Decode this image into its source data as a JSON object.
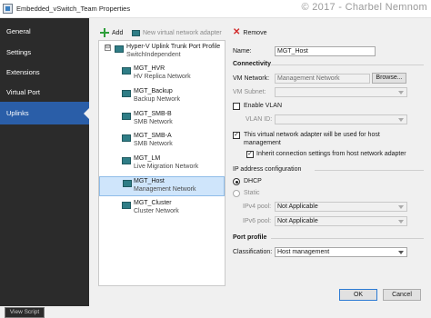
{
  "window": {
    "title": "Embedded_vSwitch_Team Properties"
  },
  "watermark": "© 2017 - Charbel Nemnom",
  "sidebar": {
    "items": [
      {
        "label": "General"
      },
      {
        "label": "Settings"
      },
      {
        "label": "Extensions"
      },
      {
        "label": "Virtual Port"
      },
      {
        "label": "Uplinks"
      }
    ],
    "active": "Uplinks",
    "view_script": "View Script"
  },
  "toolbar": {
    "add": "Add",
    "new_adapter": "New virtual network adapter",
    "remove": "Remove"
  },
  "tree": {
    "root": {
      "title": "Hyper-V Uplink Trunk Port Profile",
      "subtitle": "SwitchIndependent",
      "expander": "⊟"
    },
    "adapters": [
      {
        "name": "MGT_HVR",
        "network": "HV Replica Network"
      },
      {
        "name": "MGT_Backup",
        "network": "Backup Network"
      },
      {
        "name": "MGT_SMB-B",
        "network": "SMB Network"
      },
      {
        "name": "MGT_SMB-A",
        "network": "SMB Network"
      },
      {
        "name": "MGT_LM",
        "network": "Live Migration Network"
      },
      {
        "name": "MGT_Host",
        "network": "Management Network"
      },
      {
        "name": "MGT_Cluster",
        "network": "Cluster Network"
      }
    ],
    "selected": "MGT_Host"
  },
  "details": {
    "name_label": "Name:",
    "name_value": "MGT_Host",
    "connectivity_heading": "Connectivity",
    "vm_network_label": "VM Network:",
    "vm_network_value": "Management Network",
    "browse_label": "Browse...",
    "vm_subnet_label": "VM Subnet:",
    "vm_subnet_value": "",
    "enable_vlan_label": "Enable VLAN",
    "enable_vlan_checked": false,
    "vlan_id_label": "VLAN ID:",
    "vlan_id_value": "",
    "host_mgmt_label_1": "This virtual network adapter will be used for host",
    "host_mgmt_label_2": "management",
    "host_mgmt_checked": true,
    "inherit_label": "Inherit connection settings from host network adapter",
    "inherit_checked": true,
    "ip_heading": "IP address configuration",
    "dhcp_label": "DHCP",
    "static_label": "Static",
    "ip_mode": "DHCP",
    "ipv4_pool_label": "IPv4 pool:",
    "ipv4_pool_value": "Not Applicable",
    "ipv6_pool_label": "IPv6 pool:",
    "ipv6_pool_value": "Not Applicable",
    "port_profile_heading": "Port profile",
    "classification_label": "Classification:",
    "classification_value": "Host management"
  },
  "footer": {
    "ok": "OK",
    "cancel": "Cancel"
  },
  "colors": {
    "sidebar_bg": "#2b2b2b",
    "active_nav": "#2a5ea8",
    "selection": "#cfe5fb",
    "add_icon": "#2e9e3a",
    "remove_icon": "#d12a2a"
  }
}
